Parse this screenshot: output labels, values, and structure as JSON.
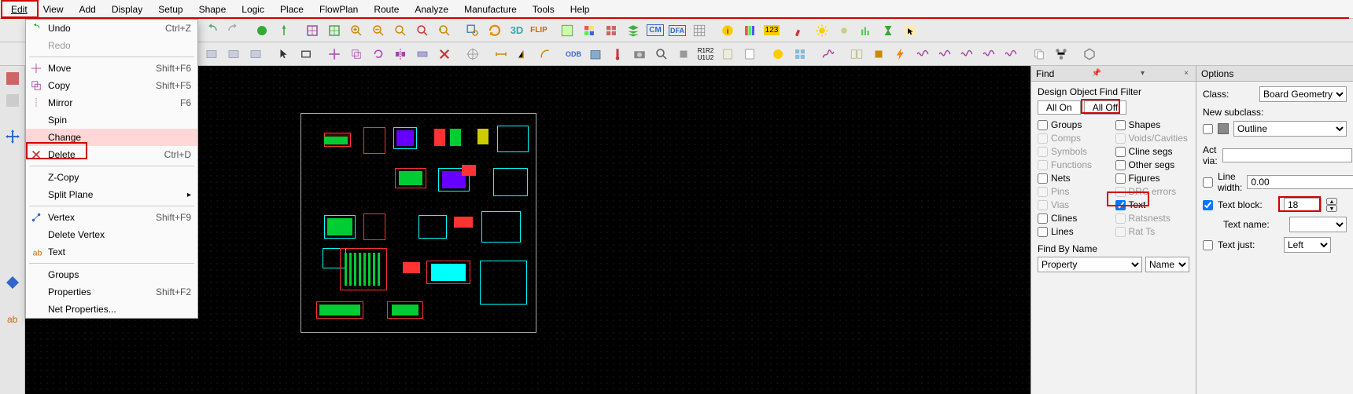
{
  "menubar": [
    "Edit",
    "View",
    "Add",
    "Display",
    "Setup",
    "Shape",
    "Logic",
    "Place",
    "FlowPlan",
    "Route",
    "Analyze",
    "Manufacture",
    "Tools",
    "Help"
  ],
  "dropdown": {
    "undo": {
      "label": "Undo",
      "shortcut": "Ctrl+Z"
    },
    "redo": {
      "label": "Redo",
      "shortcut": ""
    },
    "move": {
      "label": "Move",
      "shortcut": "Shift+F6"
    },
    "copy": {
      "label": "Copy",
      "shortcut": "Shift+F5"
    },
    "mirror": {
      "label": "Mirror",
      "shortcut": "F6"
    },
    "spin": {
      "label": "Spin",
      "shortcut": ""
    },
    "change": {
      "label": "Change",
      "shortcut": ""
    },
    "delete": {
      "label": "Delete",
      "shortcut": "Ctrl+D"
    },
    "zcopy": {
      "label": "Z-Copy",
      "shortcut": ""
    },
    "splitplane": {
      "label": "Split Plane",
      "shortcut": ""
    },
    "vertex": {
      "label": "Vertex",
      "shortcut": "Shift+F9"
    },
    "delvertex": {
      "label": "Delete Vertex",
      "shortcut": ""
    },
    "text": {
      "label": "Text",
      "shortcut": ""
    },
    "groups": {
      "label": "Groups",
      "shortcut": ""
    },
    "properties": {
      "label": "Properties",
      "shortcut": "Shift+F2"
    },
    "netprops": {
      "label": "Net Properties...",
      "shortcut": ""
    }
  },
  "find": {
    "title": "Find",
    "heading": "Design Object Find Filter",
    "all_on": "All On",
    "all_off": "All Off",
    "left": [
      {
        "label": "Groups",
        "checked": false,
        "enabled": true
      },
      {
        "label": "Comps",
        "checked": false,
        "enabled": false
      },
      {
        "label": "Symbols",
        "checked": false,
        "enabled": false
      },
      {
        "label": "Functions",
        "checked": false,
        "enabled": false
      },
      {
        "label": "Nets",
        "checked": false,
        "enabled": true
      },
      {
        "label": "Pins",
        "checked": false,
        "enabled": false
      },
      {
        "label": "Vias",
        "checked": false,
        "enabled": false
      },
      {
        "label": "Clines",
        "checked": false,
        "enabled": true
      },
      {
        "label": "Lines",
        "checked": false,
        "enabled": true
      }
    ],
    "right": [
      {
        "label": "Shapes",
        "checked": false,
        "enabled": true
      },
      {
        "label": "Voids/Cavities",
        "checked": false,
        "enabled": false
      },
      {
        "label": "Cline segs",
        "checked": false,
        "enabled": true
      },
      {
        "label": "Other segs",
        "checked": false,
        "enabled": true
      },
      {
        "label": "Figures",
        "checked": false,
        "enabled": true
      },
      {
        "label": "DRC errors",
        "checked": false,
        "enabled": false
      },
      {
        "label": "Text",
        "checked": true,
        "enabled": true
      },
      {
        "label": "Ratsnests",
        "checked": false,
        "enabled": false
      },
      {
        "label": "Rat Ts",
        "checked": false,
        "enabled": false
      }
    ],
    "find_by_name": "Find By Name",
    "property": "Property",
    "name": "Name"
  },
  "options": {
    "title": "Options",
    "class_label": "Class:",
    "class_value": "Board Geometry",
    "new_subclass": "New subclass:",
    "subclass_value": "Outline",
    "act_via": "Act via:",
    "act_via_value": "",
    "line_width_label": "Line width:",
    "line_width_value": "0.00",
    "text_block_label": "Text block:",
    "text_block_value": "18",
    "text_name_label": "Text name:",
    "text_name_value": "",
    "text_just_label": "Text just:",
    "text_just_value": "Left"
  }
}
